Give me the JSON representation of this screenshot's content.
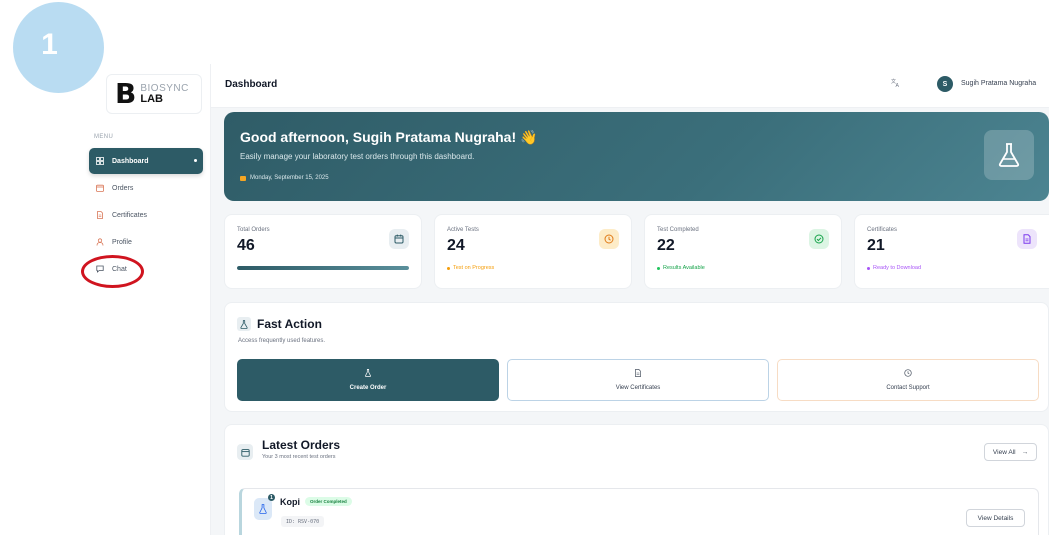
{
  "step_marker": "1",
  "brand": {
    "line1": "BIOSYNC",
    "line2": "LAB",
    "logo_letter": "B"
  },
  "sidebar": {
    "menu_label": "MENU",
    "items": [
      {
        "label": "Dashboard",
        "icon": "grid-icon",
        "active": true
      },
      {
        "label": "Orders",
        "icon": "calendar-icon",
        "active": false
      },
      {
        "label": "Certificates",
        "icon": "document-icon",
        "active": false
      },
      {
        "label": "Profile",
        "icon": "user-icon",
        "active": false
      },
      {
        "label": "Chat",
        "icon": "chat-bubble-icon",
        "active": false,
        "highlighted": true
      }
    ]
  },
  "topbar": {
    "title": "Dashboard",
    "translate_icon": "translate-icon",
    "avatar_initial": "S",
    "user_name": "Sugih Pratama Nugraha"
  },
  "hero": {
    "greeting": "Good afternoon, Sugih Pratama Nugraha! 👋",
    "subtitle": "Easily manage your laboratory test orders through this dashboard.",
    "date": "Monday, September 15, 2025",
    "icon": "flask-icon"
  },
  "stats": [
    {
      "label": "Total Orders",
      "value": "46",
      "icon": "calendar-icon",
      "progress": 1.0
    },
    {
      "label": "Active Tests",
      "value": "24",
      "icon": "clock-icon",
      "status": "Test on Progress",
      "status_color": "#f59e0b"
    },
    {
      "label": "Test Completed",
      "value": "22",
      "icon": "check-circle-icon",
      "status": "Results Available",
      "status_color": "#22c55e"
    },
    {
      "label": "Certificates",
      "value": "21",
      "icon": "document-icon",
      "status": "Ready to Download",
      "status_color": "#a855f7"
    }
  ],
  "fast_action": {
    "title": "Fast Action",
    "subtitle": "Access frequently used features.",
    "buttons": [
      {
        "label": "Create Order",
        "icon": "flask-icon"
      },
      {
        "label": "View Certificates",
        "icon": "document-icon"
      },
      {
        "label": "Contact Support",
        "icon": "clock-icon"
      }
    ]
  },
  "latest_orders": {
    "title": "Latest Orders",
    "subtitle": "Your 3 most recent test orders",
    "view_all": "View All",
    "orders": [
      {
        "name": "Kopi",
        "status": "Order Completed",
        "id": "ID: RSV-070",
        "badge": "1",
        "action": "View Details"
      }
    ]
  },
  "colors": {
    "primary": "#2d5b66",
    "highlight_ring": "#d0141f",
    "step_marker": "#b9dcf2"
  }
}
